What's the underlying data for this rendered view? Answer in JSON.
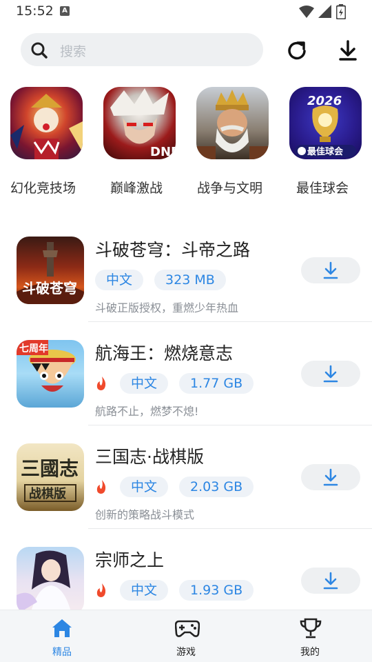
{
  "status": {
    "time": "15:52",
    "badge": "A"
  },
  "search": {
    "placeholder": "搜索"
  },
  "featured": [
    {
      "label": "幻化竞技场"
    },
    {
      "label": "巅峰激战"
    },
    {
      "label": "战争与文明"
    },
    {
      "label": "最佳球会"
    }
  ],
  "featured_icon_text": {
    "dnf": "DNF",
    "year": "2026",
    "club": "最佳球会"
  },
  "apps": [
    {
      "title": "斗破苍穹：斗帝之路",
      "lang": "中文",
      "size": "323 MB",
      "desc": "斗破正版授权，重燃少年热血",
      "hot": false,
      "icon_text": "斗破苍穹"
    },
    {
      "title": "航海王：燃烧意志",
      "lang": "中文",
      "size": "1.77 GB",
      "desc": "航路不止，燃梦不熄!",
      "hot": true,
      "icon_text": "七周年"
    },
    {
      "title": "三国志·战棋版",
      "lang": "中文",
      "size": "2.03 GB",
      "desc": "创新的策略战斗模式",
      "hot": true,
      "icon_text": "三國志",
      "icon_sub": "战棋版"
    },
    {
      "title": "宗师之上",
      "lang": "中文",
      "size": "1.93 GB",
      "desc": "",
      "hot": true
    }
  ],
  "nav": {
    "featured": "精品",
    "games": "游戏",
    "mine": "我的"
  },
  "colors": {
    "accent": "#2c86e3",
    "tag_bg": "#eef2f7",
    "fire": "#f04a2c"
  }
}
